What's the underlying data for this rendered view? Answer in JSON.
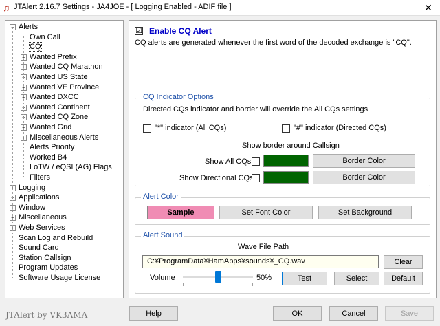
{
  "window": {
    "title": "JTAlert 2.16.7 Settings  -  JA4JOE  -  [ Logging Enabled - ADIF file ]",
    "app_icon": "music-note-icon",
    "close_label": "✕"
  },
  "tree": {
    "items": [
      {
        "label": "Alerts",
        "expander": "⊟"
      },
      {
        "label": "Own Call"
      },
      {
        "label": "CQ",
        "selected": true
      },
      {
        "label": "Wanted Prefix",
        "expander": "⊞"
      },
      {
        "label": "Wanted CQ Marathon",
        "expander": "⊞"
      },
      {
        "label": "Wanted US State",
        "expander": "⊞"
      },
      {
        "label": "Wanted VE Province",
        "expander": "⊞"
      },
      {
        "label": "Wanted DXCC",
        "expander": "⊞"
      },
      {
        "label": "Wanted Continent",
        "expander": "⊞"
      },
      {
        "label": "Wanted CQ Zone",
        "expander": "⊞"
      },
      {
        "label": "Wanted Grid",
        "expander": "⊞"
      },
      {
        "label": "Miscellaneous Alerts",
        "expander": "⊞"
      },
      {
        "label": "Alerts Priority"
      },
      {
        "label": "Worked B4"
      },
      {
        "label": "LoTW / eQSL(AG) Flags"
      },
      {
        "label": "Filters"
      },
      {
        "label": "Logging",
        "expander": "⊞"
      },
      {
        "label": "Applications",
        "expander": "⊞"
      },
      {
        "label": "Window",
        "expander": "⊞"
      },
      {
        "label": "Miscellaneous",
        "expander": "⊞"
      },
      {
        "label": "Web Services",
        "expander": "⊞"
      },
      {
        "label": "Scan Log and Rebuild"
      },
      {
        "label": "Sound Card"
      },
      {
        "label": "Station Callsign"
      },
      {
        "label": "Program Updates"
      },
      {
        "label": "Software Usage License"
      }
    ]
  },
  "main": {
    "enable_checked": "☑",
    "enable_label": "Enable CQ Alert",
    "description": "CQ alerts are generated whenever the first word of the decoded exchange is \"CQ\".",
    "indicator": {
      "title": "CQ Indicator Options",
      "note": "Directed CQs indicator and border will override the All CQs settings",
      "all_cqs_label": "\"*\" indicator (All CQs)",
      "directed_label": "\"#\" indicator (Directed CQs)",
      "border_heading": "Show border around Callsign",
      "show_all_label": "Show All CQs",
      "show_directional_label": "Show Directional CQs",
      "border_color_label": "Border Color",
      "border_swatch_color": "#006400"
    },
    "alert_color": {
      "title": "Alert Color",
      "sample_label": "Sample",
      "sample_color": "#f08cb4",
      "set_font_label": "Set Font Color",
      "set_background_label": "Set Background"
    },
    "alert_sound": {
      "title": "Alert Sound",
      "wave_heading": "Wave File Path",
      "file_path": "C:¥ProgramData¥HamApps¥sounds¥_CQ.wav",
      "clear_label": "Clear",
      "volume_label": "Volume",
      "volume_value": "50%",
      "volume_fraction": 0.5,
      "test_label": "Test",
      "select_label": "Select",
      "default_label": "Default"
    }
  },
  "footer": {
    "brand": "JTAlert by VK3AMA",
    "help_label": "Help",
    "ok_label": "OK",
    "cancel_label": "Cancel",
    "save_label": "Save"
  },
  "colors": {
    "accent": "#1c4fa8",
    "enable_label": "#0000c8",
    "slider": "#0078d7"
  }
}
